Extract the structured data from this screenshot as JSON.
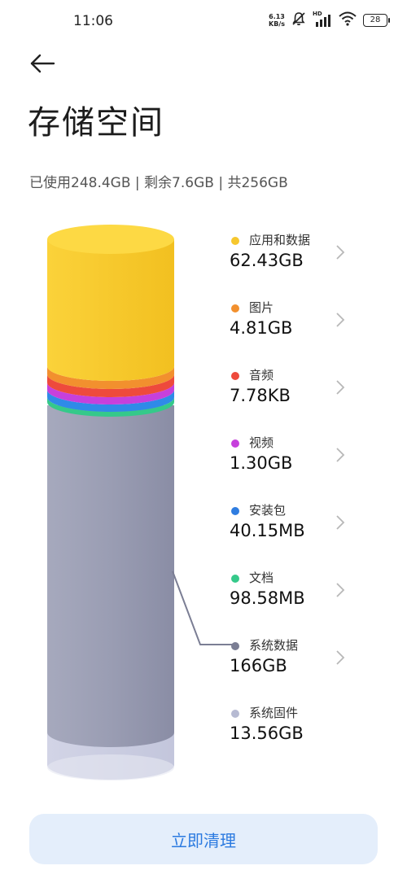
{
  "status_bar": {
    "time": "11:06",
    "net_speed_value": "6.13",
    "net_speed_unit": "KB/s",
    "hd_label": "HD",
    "battery": "28",
    "icons": [
      "bell-muted-icon",
      "signal-icon",
      "wifi-icon",
      "battery-icon"
    ]
  },
  "header": {
    "back_icon": "arrow-left-icon",
    "title": "存储空间"
  },
  "summary": "已使用248.4GB | 剩余7.6GB | 共256GB",
  "legend": [
    {
      "label": "应用和数据",
      "value": "62.43GB",
      "color": "#f6c72e",
      "has_chevron": true
    },
    {
      "label": "图片",
      "value": "4.81GB",
      "color": "#f2902e",
      "has_chevron": true
    },
    {
      "label": "音频",
      "value": "7.78KB",
      "color": "#ee4a3c",
      "has_chevron": true
    },
    {
      "label": "视频",
      "value": "1.30GB",
      "color": "#c640dc",
      "has_chevron": true
    },
    {
      "label": "安装包",
      "value": "40.15MB",
      "color": "#2f7de0",
      "has_chevron": true
    },
    {
      "label": "文档",
      "value": "98.58MB",
      "color": "#35c98a",
      "has_chevron": true
    },
    {
      "label": "系统数据",
      "value": "166GB",
      "color": "#7b7e94",
      "has_chevron": true
    },
    {
      "label": "系统固件",
      "value": "13.56GB",
      "color": "#b6bad2",
      "has_chevron": false
    }
  ],
  "clean_button": "立即清理"
}
